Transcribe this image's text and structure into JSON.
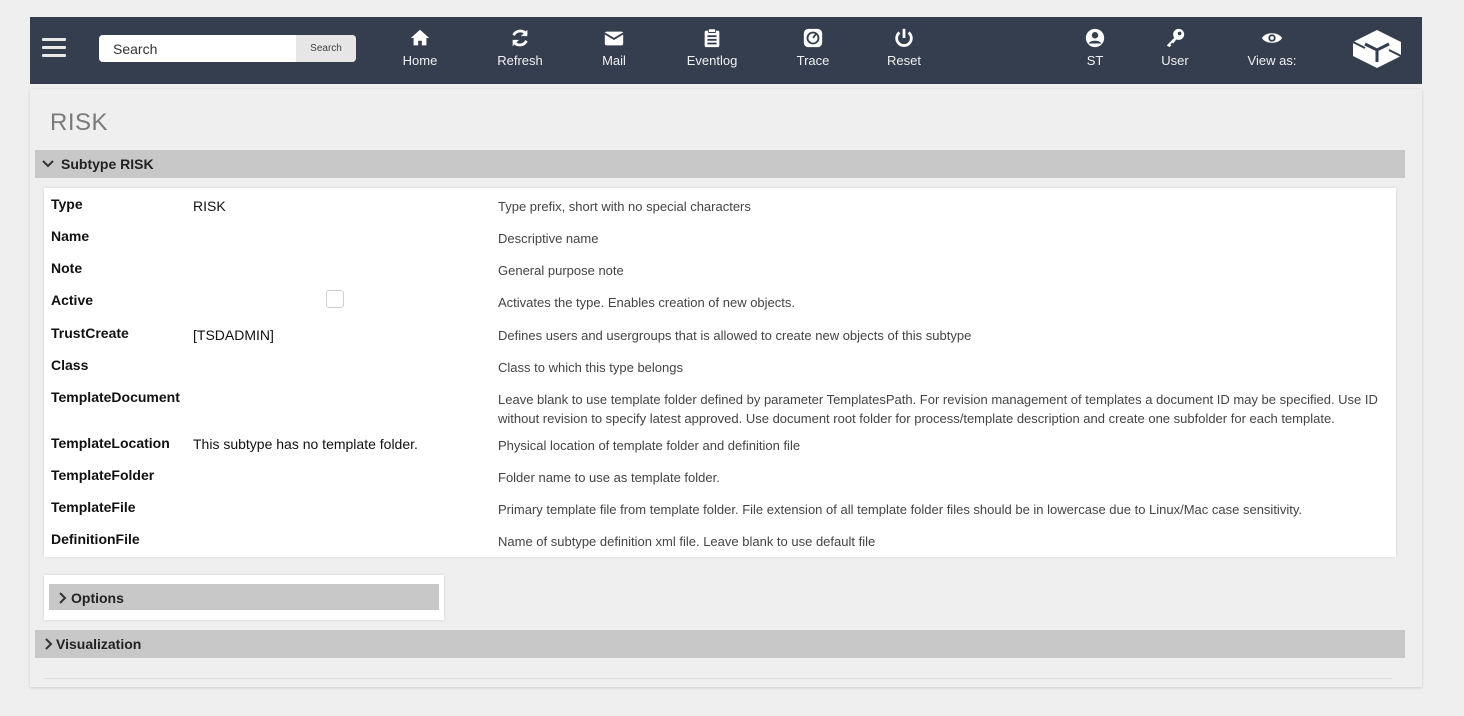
{
  "search": {
    "placeholder": "Search",
    "button_label": "Search"
  },
  "nav": [
    {
      "label": "Home",
      "icon": "home-icon"
    },
    {
      "label": "Refresh",
      "icon": "refresh-icon"
    },
    {
      "label": "Mail",
      "icon": "mail-icon"
    },
    {
      "label": "Eventlog",
      "icon": "clipboard-icon"
    },
    {
      "label": "Trace",
      "icon": "trace-icon"
    },
    {
      "label": "Reset",
      "icon": "power-icon"
    }
  ],
  "user_nav": [
    {
      "label": "ST",
      "icon": "user-icon"
    },
    {
      "label": "User",
      "icon": "key-icon"
    },
    {
      "label": "View as:",
      "icon": "eye-icon"
    }
  ],
  "page_title": "RISK",
  "sections": {
    "subtype": "Subtype RISK",
    "options": "Options",
    "visualization": "Visualization"
  },
  "fields": [
    {
      "name": "Type",
      "value": "RISK",
      "desc": "Type prefix, short with no special characters"
    },
    {
      "name": "Name",
      "value": "",
      "desc": "Descriptive name"
    },
    {
      "name": "Note",
      "value": "",
      "desc": "General purpose note"
    },
    {
      "name": "Active",
      "value": "",
      "desc": "Activates the type. Enables creation of new objects."
    },
    {
      "name": "TrustCreate",
      "value": "[TSDADMIN]",
      "desc": "Defines users and usergroups that is allowed to create new objects of this subtype"
    },
    {
      "name": "Class",
      "value": "",
      "desc": "Class to which this type belongs"
    },
    {
      "name": "TemplateDocument",
      "value": "",
      "desc": "Leave blank to use template folder defined by parameter TemplatesPath. For revision management of templates a document ID may be specified. Use ID without revision to specify latest approved. Use document root folder for process/template description and create one subfolder for each template."
    },
    {
      "name": "TemplateLocation",
      "value": "This subtype has no template folder.",
      "desc": "Physical location of template folder and definition file"
    },
    {
      "name": "TemplateFolder",
      "value": "",
      "desc": "Folder name to use as template folder."
    },
    {
      "name": "TemplateFile",
      "value": "",
      "desc": "Primary template file from template folder. File extension of all template folder files should be in lowercase due to Linux/Mac case sensitivity."
    },
    {
      "name": "DefinitionFile",
      "value": "",
      "desc": "Name of subtype definition xml file. Leave blank to use default file"
    }
  ],
  "colors": {
    "topbar": "#353e4f",
    "section": "#c8c8c8",
    "link": "#2a6ab5"
  }
}
